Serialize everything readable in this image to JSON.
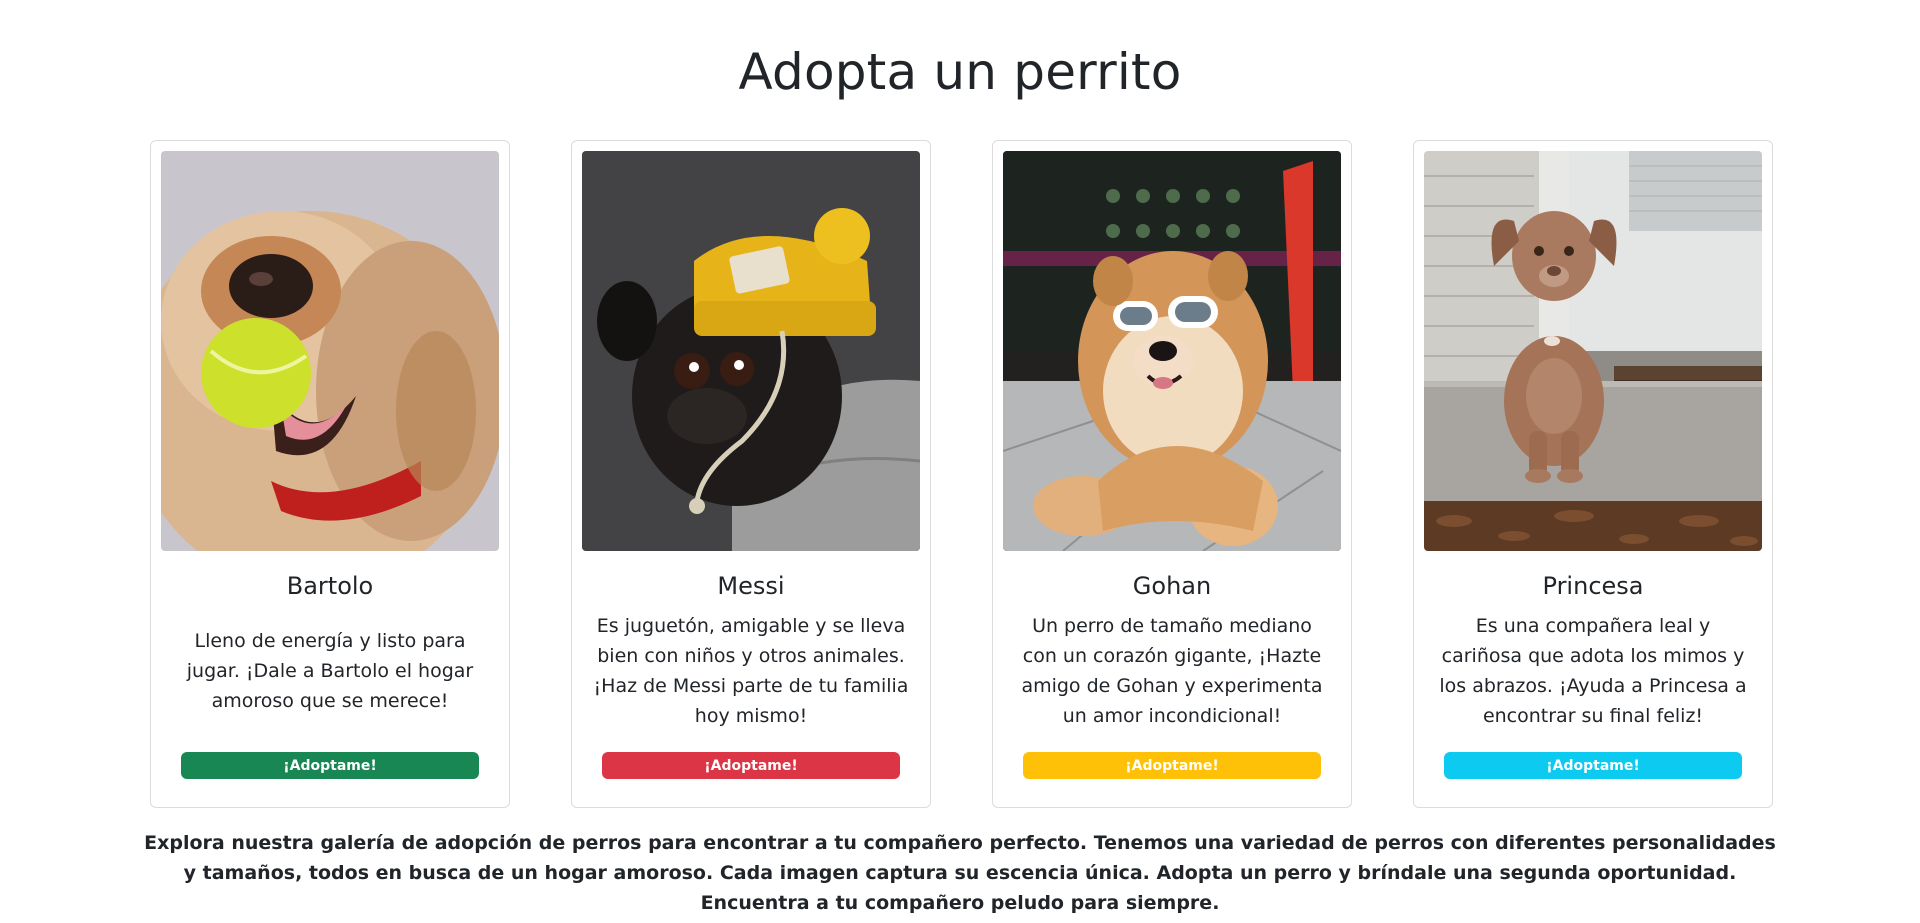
{
  "page": {
    "title": "Adopta un perrito",
    "footer": "Explora nuestra galería de adopción de perros para encontrar a tu compañero perfecto. Tenemos una variedad de perros con diferentes personalidades y tamaños, todos en busca de un hogar amoroso. Cada imagen captura su escencia única. Adopta un perro y bríndale una segunda oportunidad. Encuentra a tu compañero peludo para siempre."
  },
  "dogs": [
    {
      "name": "Bartolo",
      "description": "Lleno de energía y listo para jugar. ¡Dale a Bartolo el hogar amoroso que se merece!",
      "button_label": "¡Adoptame!",
      "button_color": "#198754",
      "photo": "goldendoodle-with-tennis-ball"
    },
    {
      "name": "Messi",
      "description": "Es juguetón, amigable y se lleva bien con niños y otros animales. ¡Haz de Messi parte de tu familia hoy mismo!",
      "button_label": "¡Adoptame!",
      "button_color": "#dc3545",
      "photo": "pug-with-yellow-beanie"
    },
    {
      "name": "Gohan",
      "description": "Un perro de tamaño mediano con un corazón gigante, ¡Hazte amigo de Gohan y experimenta un amor incondicional!",
      "button_label": "¡Adoptame!",
      "button_color": "#ffc107",
      "photo": "chow-chow-with-sunglasses"
    },
    {
      "name": "Princesa",
      "description": "Es una compañera leal y cariñosa que adota los mimos y los abrazos. ¡Ayuda a Princesa a encontrar su final feliz!",
      "button_label": "¡Adoptame!",
      "button_color": "#0dcaf0",
      "photo": "brown-puppy-on-doorstep"
    }
  ]
}
